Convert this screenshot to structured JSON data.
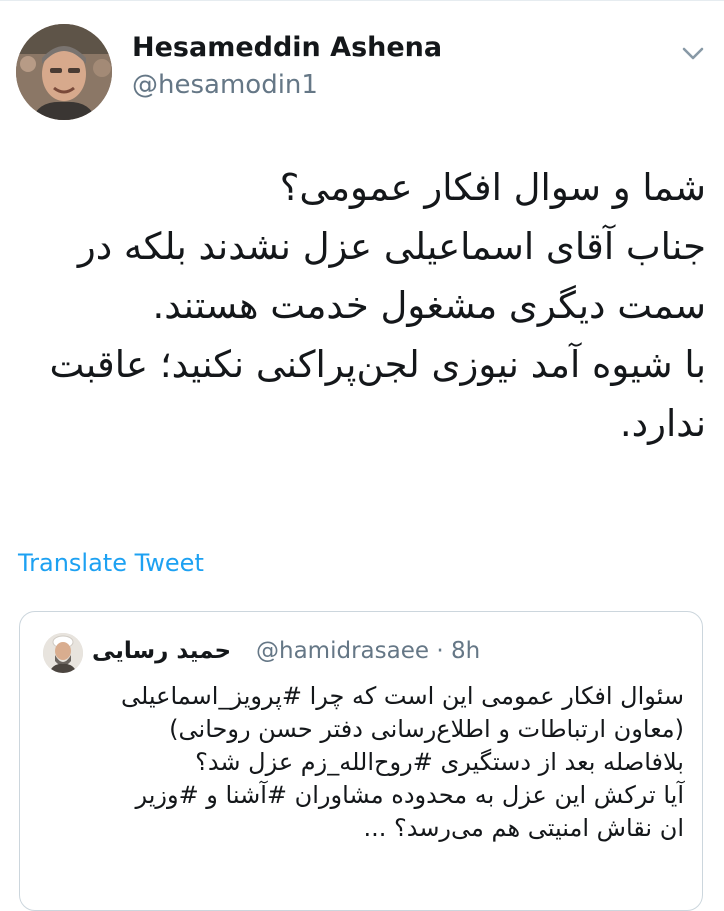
{
  "tweet": {
    "author_name": "Hesameddin Ashena",
    "author_handle": "@hesamodin1",
    "text_lines": [
      "شما و سوال افکار عمومی؟",
      "جناب آقای اسماعیلی عزل نشدند بلکه در",
      "سمت دیگری مشغول خدمت هستند.",
      "با شیوه آمد نیوزی لجن‌پراکنی نکنید؛ عاقبت",
      "ندارد."
    ],
    "translate_label": "Translate Tweet"
  },
  "quoted": {
    "author_name": "حمید رسایی",
    "author_handle": "@hamidrasaee",
    "separator": "·",
    "time": "8h",
    "text_lines": [
      "سئوال افکار عمومی این است که چرا #پرویز_اسماعیلی",
      "(معاون ارتباطات و اطلاع‌رسانی دفتر حسن روحانی)",
      "بلافاصله بعد از دستگیری #روح‌الله_زم عزل شد؟",
      "آیا ترکش این عزل به محدوده مشاوران #آشنا و #وزیر",
      "ان نقاش امنیتی هم می‌رسد؟ ..."
    ]
  },
  "icons": {
    "menu": "chevron-down-icon"
  },
  "colors": {
    "link": "#1da1f2",
    "secondary_text": "#657786",
    "border": "#ccd6dd"
  }
}
